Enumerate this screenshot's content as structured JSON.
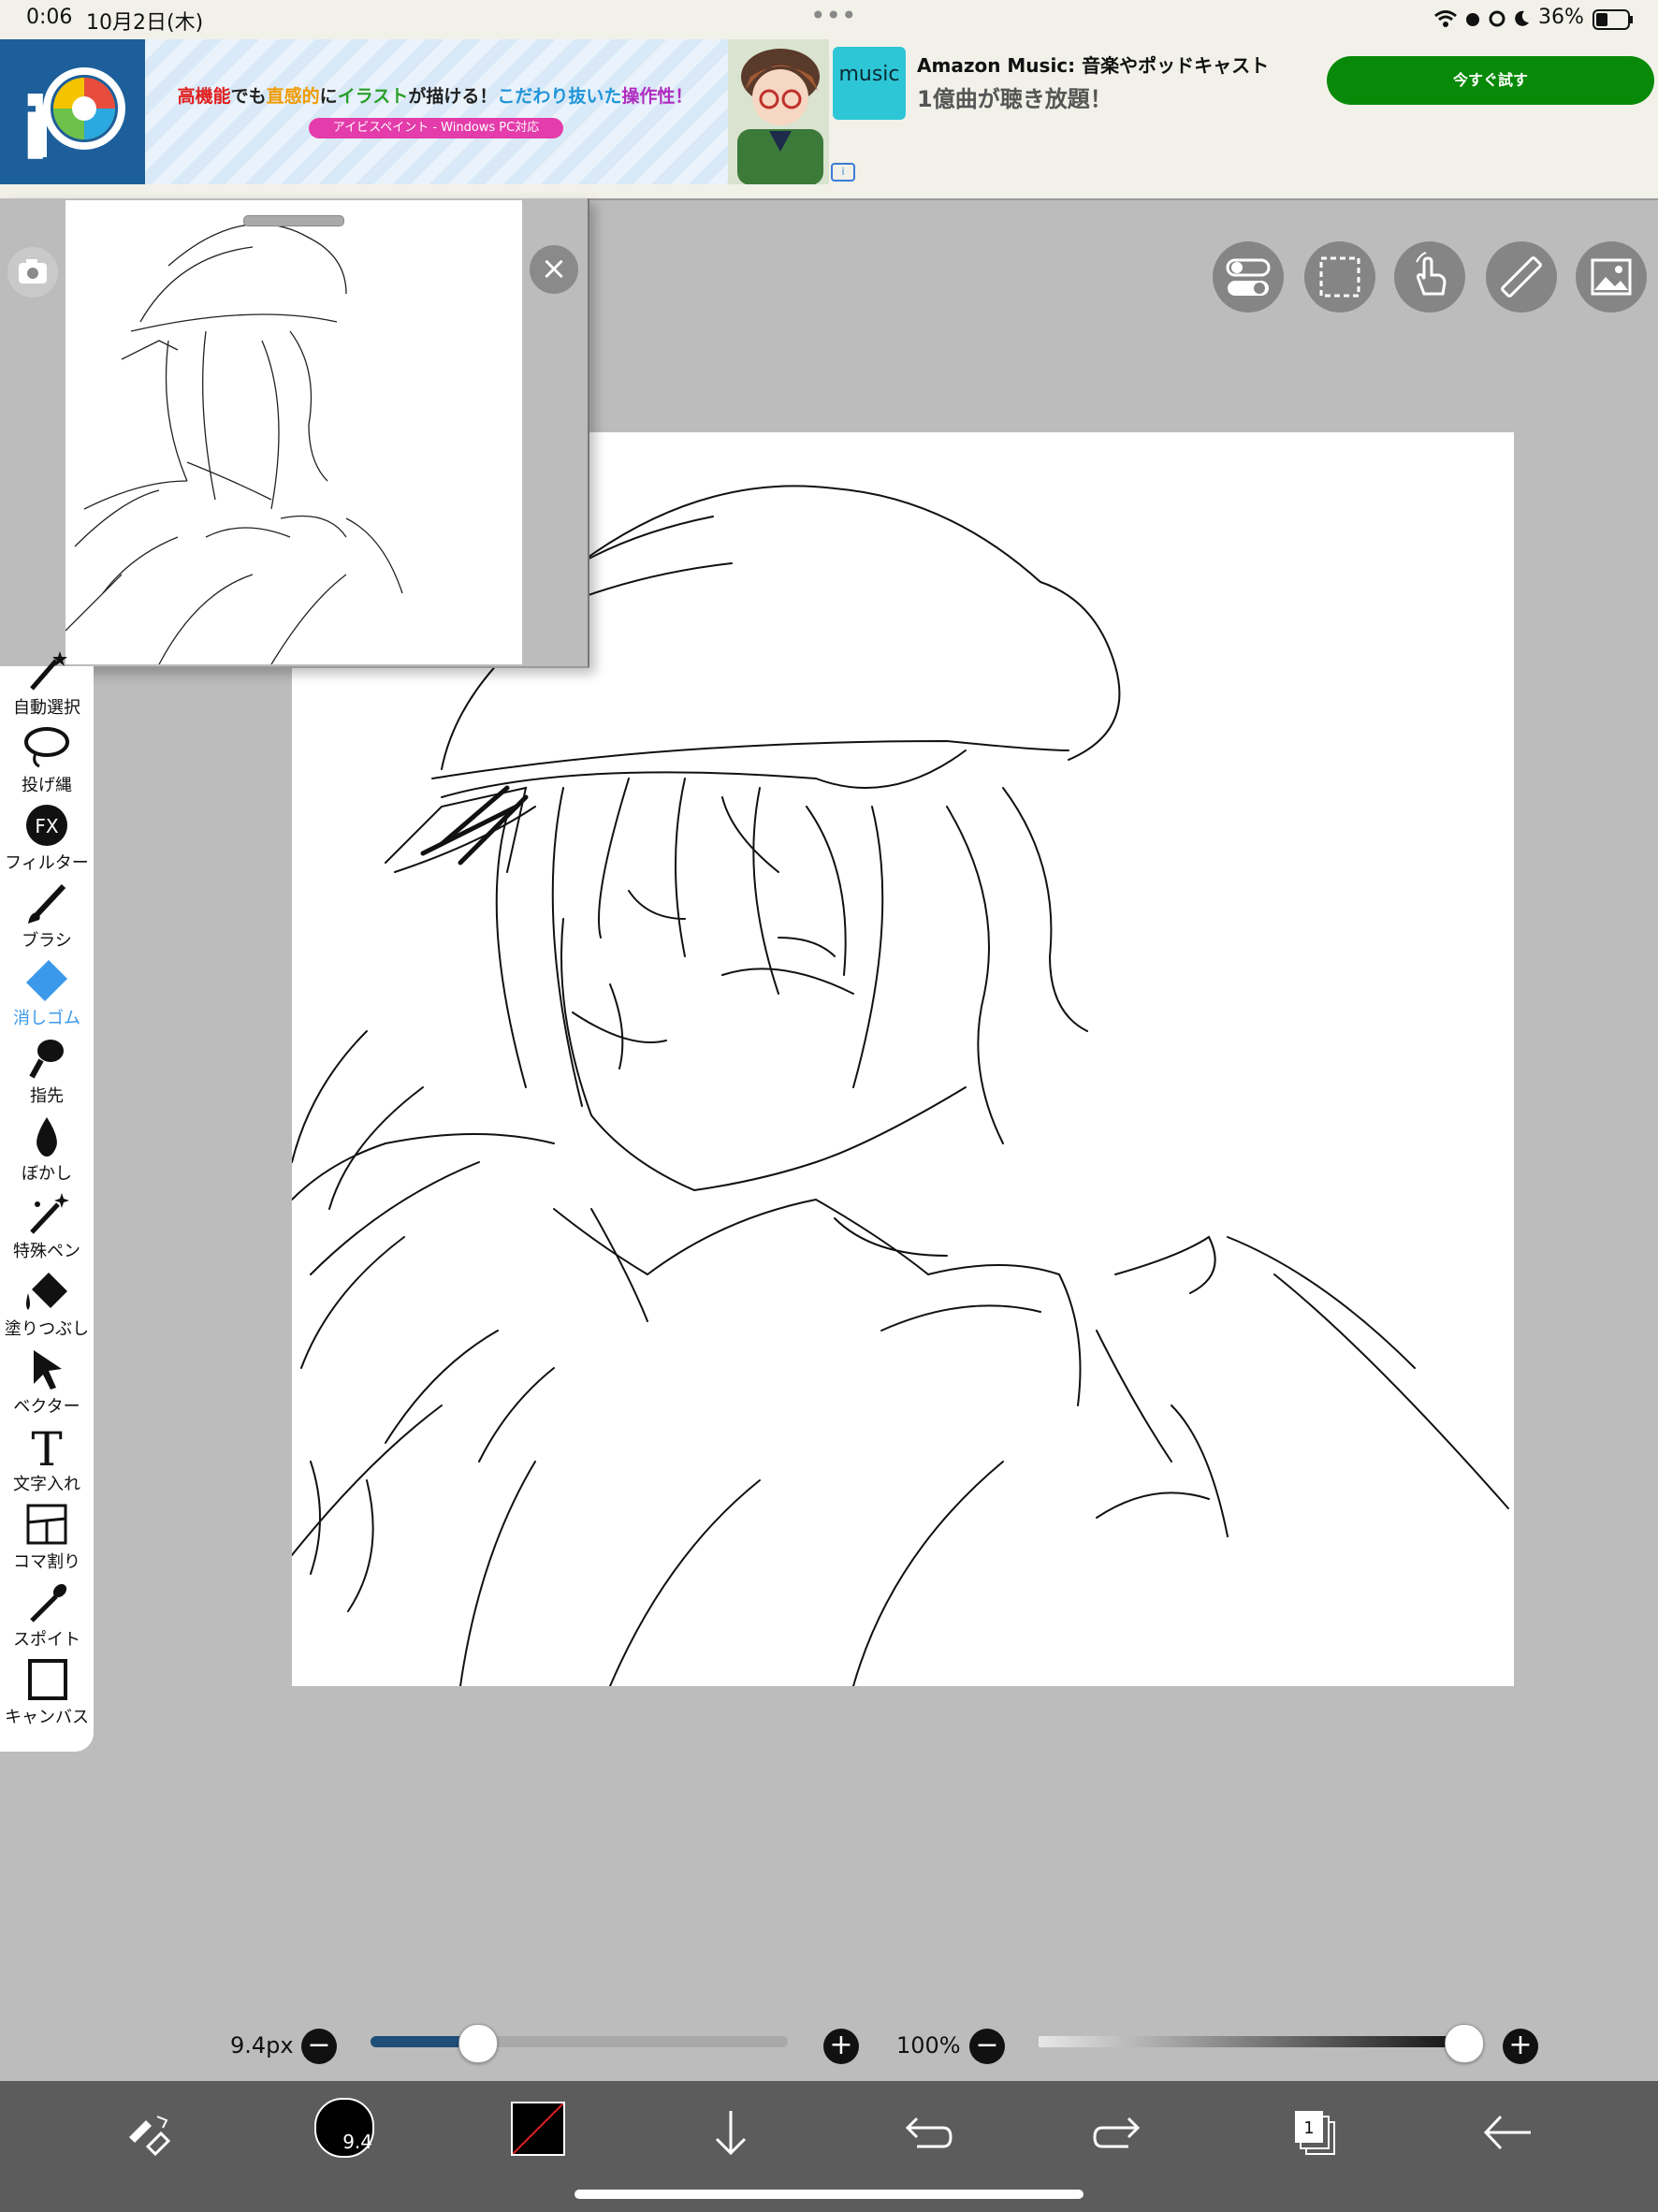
{
  "status": {
    "time": "0:06",
    "date": "10月2日(木)",
    "dots": "•••",
    "battery": "36%"
  },
  "ad": {
    "caption_parts": [
      "高機能",
      "でも",
      "直感的",
      "に",
      "イラスト",
      "が描ける！",
      "こだわり抜いた",
      "操作性！"
    ],
    "sub": "アイビスペイント - Windows PC対応",
    "logo_text": "iP",
    "music_logo": "music",
    "music_title": "Amazon Music: 音楽やポッドキャスト",
    "music_sub": "1億曲が聴き放題！",
    "cta": "今すぐ試す",
    "info": "i"
  },
  "tools": [
    {
      "name": "auto-select",
      "label": "自動選択",
      "icon": "magic-wand-icon"
    },
    {
      "name": "lasso",
      "label": "投げ縄",
      "icon": "lasso-icon"
    },
    {
      "name": "filter",
      "label": "フィルター",
      "icon": "fx-icon",
      "glyph": "FX"
    },
    {
      "name": "brush",
      "label": "ブラシ",
      "icon": "brush-icon"
    },
    {
      "name": "eraser",
      "label": "消しゴム",
      "icon": "eraser-icon",
      "active": true
    },
    {
      "name": "smudge",
      "label": "指先",
      "icon": "finger-icon"
    },
    {
      "name": "blur",
      "label": "ぼかし",
      "icon": "drop-icon"
    },
    {
      "name": "special-pen",
      "label": "特殊ペン",
      "icon": "sparkle-pen-icon"
    },
    {
      "name": "fill",
      "label": "塗りつぶし",
      "icon": "bucket-icon"
    },
    {
      "name": "vector",
      "label": "ベクター",
      "icon": "cursor-arrow-icon"
    },
    {
      "name": "text",
      "label": "文字入れ",
      "icon": "text-icon",
      "glyph": "T"
    },
    {
      "name": "frame-divider",
      "label": "コマ割り",
      "icon": "panels-icon"
    },
    {
      "name": "eyedropper",
      "label": "スポイト",
      "icon": "eyedropper-icon"
    },
    {
      "name": "canvas",
      "label": "キャンバス",
      "icon": "canvas-icon"
    }
  ],
  "top_right_buttons": [
    "toggle-icon",
    "selection-rect-icon",
    "hand-gesture-icon",
    "ruler-icon",
    "image-icon"
  ],
  "brush_size": {
    "label": "9.4px",
    "fraction": 0.21
  },
  "opacity": {
    "label": "100%",
    "fraction": 1.0
  },
  "bottom_bar": {
    "brush_preview_value": "9.4",
    "layer_count": "1",
    "icons": [
      "swap-tool-icon",
      "brush-preview-icon",
      "color-swatch-icon",
      "download-arrow-icon",
      "undo-icon",
      "redo-icon",
      "layers-icon",
      "back-arrow-icon"
    ]
  },
  "ref_close": "×",
  "colors": {
    "caption_red": "#e02020",
    "caption_orange": "#f09a00",
    "caption_green": "#2aa02a",
    "caption_blue": "#1f94d8",
    "caption_purple": "#b02cc0",
    "eraser_active": "#3b98ea",
    "cta_green": "#088a08"
  }
}
